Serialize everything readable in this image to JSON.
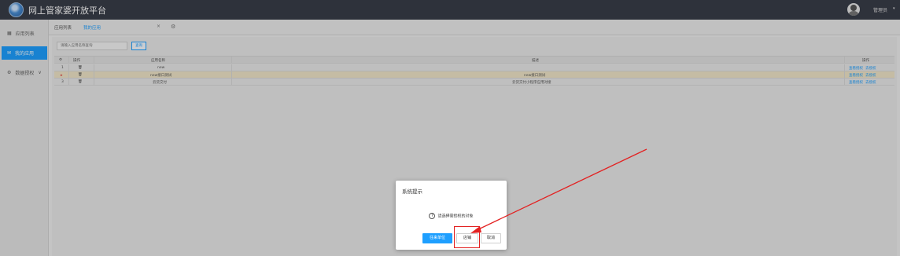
{
  "app": {
    "title": "网上管家婆开放平台",
    "user_name": "管理员",
    "user_caret": "▾"
  },
  "sidebar": {
    "items": [
      {
        "label": "应用列表",
        "icon": "grid-icon",
        "glyph": "▦"
      },
      {
        "label": "我的应用",
        "icon": "mail-icon",
        "glyph": "✉"
      },
      {
        "label": "数据授权",
        "icon": "gear-icon",
        "glyph": "⚙",
        "suffix": "∨"
      }
    ]
  },
  "tabs": [
    {
      "label": "应用列表"
    },
    {
      "label": "我的应用"
    }
  ],
  "tab_close": "×",
  "tab_gear": "⚙",
  "search": {
    "placeholder": "请输入应用名称查询",
    "button_label": "查询"
  },
  "table": {
    "header": {
      "gear": "⚙",
      "op_left": "操作",
      "name": "应用名称",
      "desc": "描述",
      "op_right": "操作"
    },
    "rows": [
      {
        "index": "1",
        "name": "new",
        "desc": "",
        "actions": [
          "查看授权",
          "去授权"
        ]
      },
      {
        "index": "▸",
        "name": "new接口测试",
        "desc": "new接口测试",
        "actions": [
          "查看授权",
          "去授权"
        ]
      },
      {
        "index": "3",
        "name": "云货交付",
        "desc": "云货交付小程序应用对接",
        "actions": [
          "查看授权",
          "去授权"
        ]
      }
    ]
  },
  "dialog": {
    "title": "系统提示",
    "message": "请选择需授权的对象",
    "question_glyph": "?",
    "buttons": {
      "primary": "往来单位",
      "continue": "店铺",
      "cancel": "取消"
    }
  },
  "colors": {
    "accent": "#1e9fff",
    "topbar": "#393d49",
    "highlight": "#e32222",
    "selected_row": "#f1e6c8"
  }
}
